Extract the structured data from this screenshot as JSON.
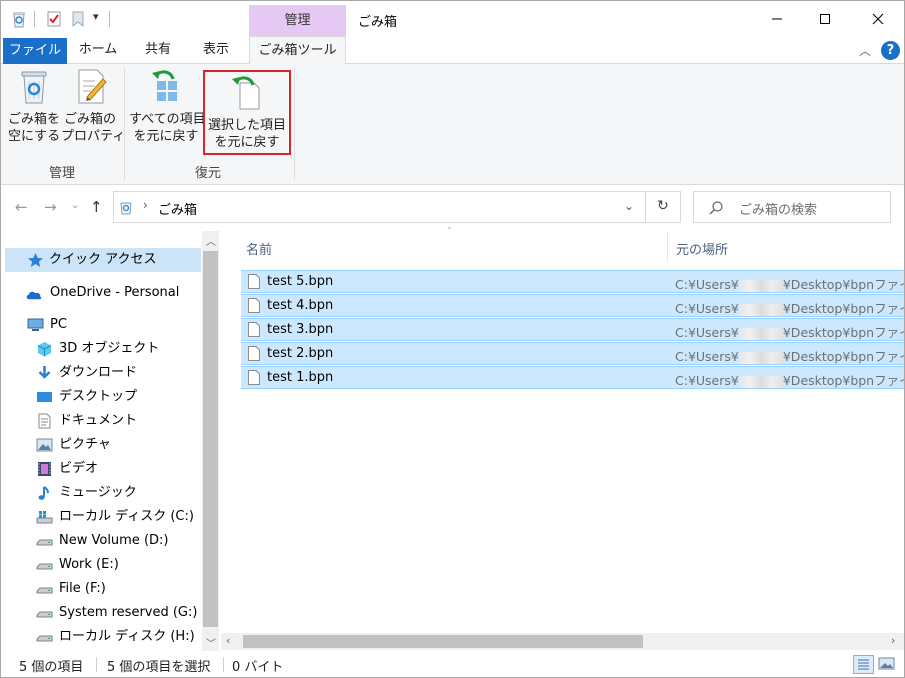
{
  "window": {
    "title": "ごみ箱",
    "context_tab_header": "管理"
  },
  "ribbon_tabs": {
    "file": "ファイル",
    "home": "ホーム",
    "share": "共有",
    "view": "表示",
    "recycle_tools": "ごみ箱ツール"
  },
  "ribbon": {
    "groups": {
      "manage": {
        "label": "管理",
        "empty": {
          "line1": "ごみ箱を",
          "line2": "空にする"
        },
        "properties": {
          "line1": "ごみ箱の",
          "line2": "プロパティ"
        }
      },
      "restore": {
        "label": "復元",
        "restore_all": {
          "line1": "すべての項目",
          "line2": "を元に戻す"
        },
        "restore_selected": {
          "line1": "選択した項目",
          "line2": "を元に戻す"
        }
      }
    }
  },
  "address": {
    "path": "ごみ箱",
    "search_placeholder": "ごみ箱の検索"
  },
  "nav": {
    "items": [
      {
        "label": "クイック アクセス",
        "icon": "star-icon"
      },
      {
        "label": "OneDrive - Personal",
        "icon": "cloud-icon"
      },
      {
        "label": "PC",
        "icon": "pc-icon"
      },
      {
        "label": "3D オブジェクト",
        "icon": "cube-icon"
      },
      {
        "label": "ダウンロード",
        "icon": "download-icon"
      },
      {
        "label": "デスクトップ",
        "icon": "desktop-icon"
      },
      {
        "label": "ドキュメント",
        "icon": "document-icon"
      },
      {
        "label": "ピクチャ",
        "icon": "picture-icon"
      },
      {
        "label": "ビデオ",
        "icon": "video-icon"
      },
      {
        "label": "ミュージック",
        "icon": "music-icon"
      },
      {
        "label": "ローカル ディスク (C:)",
        "icon": "windows-drive-icon"
      },
      {
        "label": "New Volume (D:)",
        "icon": "drive-icon"
      },
      {
        "label": "Work (E:)",
        "icon": "drive-icon"
      },
      {
        "label": "File (F:)",
        "icon": "drive-icon"
      },
      {
        "label": "System reserved (G:)",
        "icon": "drive-icon"
      },
      {
        "label": "ローカル ディスク (H:)",
        "icon": "drive-icon"
      }
    ]
  },
  "file_list": {
    "columns": {
      "name": "名前",
      "original_location": "元の場所"
    },
    "rows": [
      {
        "name": "test 5.bpn",
        "path_prefix": "C:¥Users¥",
        "path_suffix": "¥Desktop¥bpnファイル"
      },
      {
        "name": "test 4.bpn",
        "path_prefix": "C:¥Users¥",
        "path_suffix": "¥Desktop¥bpnファイル"
      },
      {
        "name": "test 3.bpn",
        "path_prefix": "C:¥Users¥",
        "path_suffix": "¥Desktop¥bpnファイル"
      },
      {
        "name": "test 2.bpn",
        "path_prefix": "C:¥Users¥",
        "path_suffix": "¥Desktop¥bpnファイル"
      },
      {
        "name": "test 1.bpn",
        "path_prefix": "C:¥Users¥",
        "path_suffix": "¥Desktop¥bpnファイル"
      }
    ]
  },
  "status": {
    "item_count": "5 個の項目",
    "selected": "5 個の項目を選択",
    "size": "0 バイト"
  },
  "colors": {
    "accent": "#1a6fc9",
    "context_tab": "#e6c8f4",
    "selection": "#cce8ff",
    "highlight_box": "#d9262c"
  }
}
